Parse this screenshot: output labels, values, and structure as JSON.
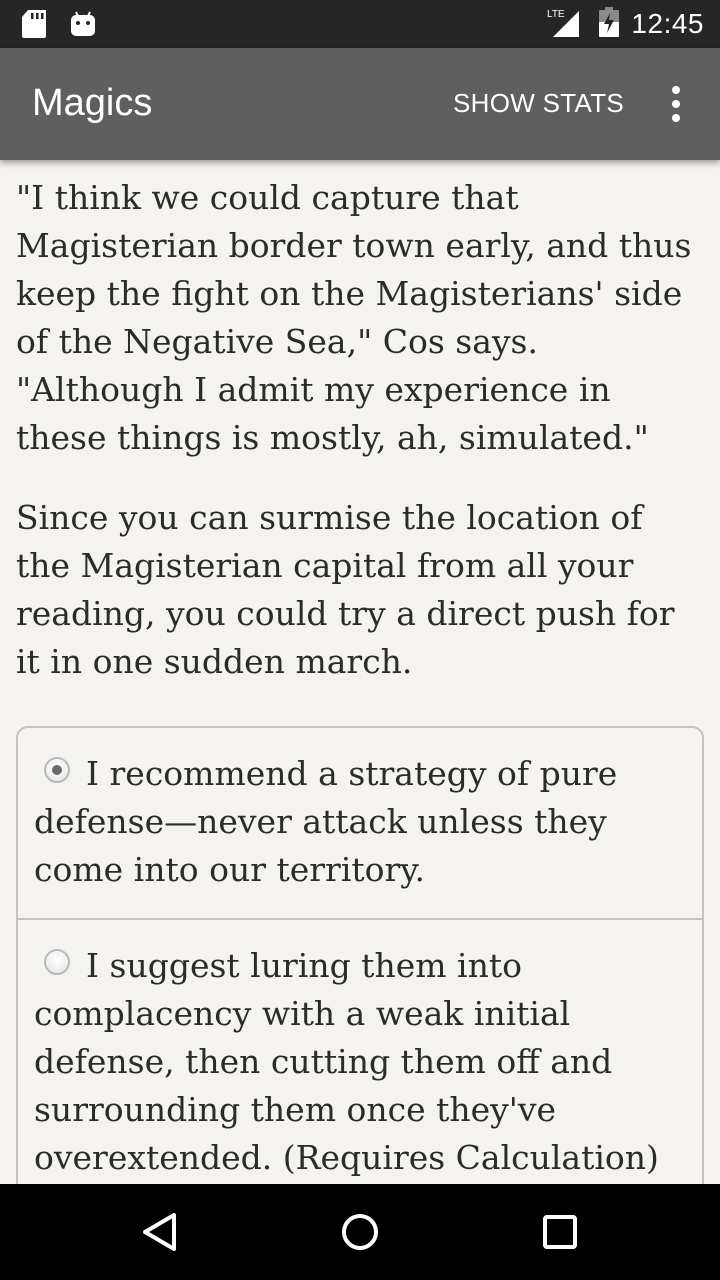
{
  "status_bar": {
    "time": "12:45",
    "network": "LTE",
    "left_icons": [
      "sd-card-icon",
      "android-icon"
    ],
    "right_icons": [
      "signal-icon",
      "battery-charging-icon"
    ]
  },
  "app_bar": {
    "title": "Magics",
    "show_stats_label": "SHOW STATS",
    "overflow_icon": "more-vert-icon"
  },
  "story": {
    "paragraphs": [
      "\"I think we could capture that Magisterian border town early, and thus keep the fight on the Magisterians' side of the Negative Sea,\" Cos says. \"Although I admit my experience in these things is mostly, ah, simulated.\"",
      "Since you can surmise the location of the Magisterian capital from all your reading, you could try a direct push for it in one sudden march."
    ]
  },
  "choices": [
    {
      "label": "I recommend a strategy of pure defense—never attack unless they come into our territory.",
      "selected": true
    },
    {
      "label": "I suggest luring them into complacency with a weak initial defense, then cutting them off and surrounding them once they've overextended. (Requires Calculation)",
      "selected": false
    }
  ],
  "nav_bar": {
    "icons": [
      "back-icon",
      "home-icon",
      "recents-icon"
    ]
  },
  "colors": {
    "status_bar": "#262626",
    "app_bar": "#5f5f5f",
    "background": "#f5f3f0",
    "text": "#2b2b2b",
    "nav_bar": "#000000"
  }
}
